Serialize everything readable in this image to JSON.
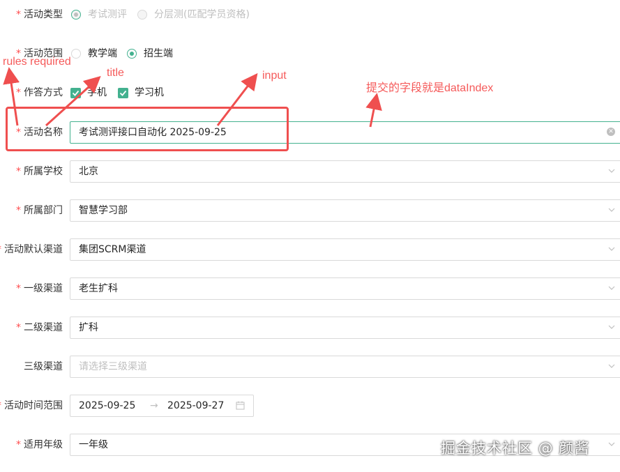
{
  "form": {
    "activity_type": {
      "label": "活动类型",
      "options": [
        "考试测评",
        "分层测(匹配学员资格)"
      ]
    },
    "activity_scope": {
      "label": "活动范围",
      "options": [
        "教学端",
        "招生端"
      ]
    },
    "answer_method": {
      "label": "作答方式",
      "options": [
        "手机",
        "学习机"
      ]
    },
    "activity_name": {
      "label": "活动名称",
      "value": "考试测评接口自动化 2025-09-25"
    },
    "school": {
      "label": "所属学校",
      "value": "北京"
    },
    "department": {
      "label": "所属部门",
      "value": "智慧学习部"
    },
    "default_channel": {
      "label": "活动默认渠道",
      "value": "集团SCRM渠道"
    },
    "level1_channel": {
      "label": "一级渠道",
      "value": "老生扩科"
    },
    "level2_channel": {
      "label": "二级渠道",
      "value": "扩科"
    },
    "level3_channel": {
      "label": "三级渠道",
      "placeholder": "请选择三级渠道"
    },
    "time_range": {
      "label": "活动时间范围",
      "start": "2025-09-25",
      "end": "2025-09-27",
      "sep": "→"
    },
    "grade": {
      "label": "适用年级",
      "value": "一年级"
    }
  },
  "required_mark": "*",
  "annotations": {
    "rules": "rules required",
    "title": "title",
    "input": "input",
    "datalndex": "提交的字段就是dataIndex"
  },
  "watermark": "掘金技术社区 @ 颜酱",
  "colors": {
    "accent": "#43b18f",
    "required": "#ff4d4f",
    "annotation": "#ef4f4f"
  }
}
